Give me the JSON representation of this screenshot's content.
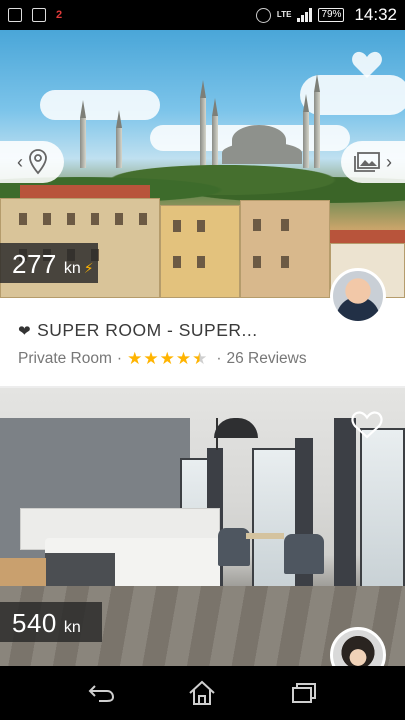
{
  "status_bar": {
    "notification_badge": "2",
    "network": "LTE",
    "battery": "79%",
    "time": "14:32"
  },
  "listings": [
    {
      "price": "277",
      "currency": "kn",
      "instant_book": true,
      "title": "SUPER ROOM - SUPER...",
      "room_type": "Private Room",
      "rating_stars": 4.5,
      "reviews": "26 Reviews",
      "favorited": true
    },
    {
      "price": "540",
      "currency": "kn",
      "instant_book": false,
      "favorited": false
    }
  ],
  "icons": {
    "map": "map-pin-icon",
    "photos": "image-gallery-icon",
    "back": "back-icon",
    "home": "home-icon",
    "recents": "recent-apps-icon"
  },
  "colors": {
    "star": "#ffb400",
    "price_bg": "#282828",
    "status_bar": "#000000"
  }
}
